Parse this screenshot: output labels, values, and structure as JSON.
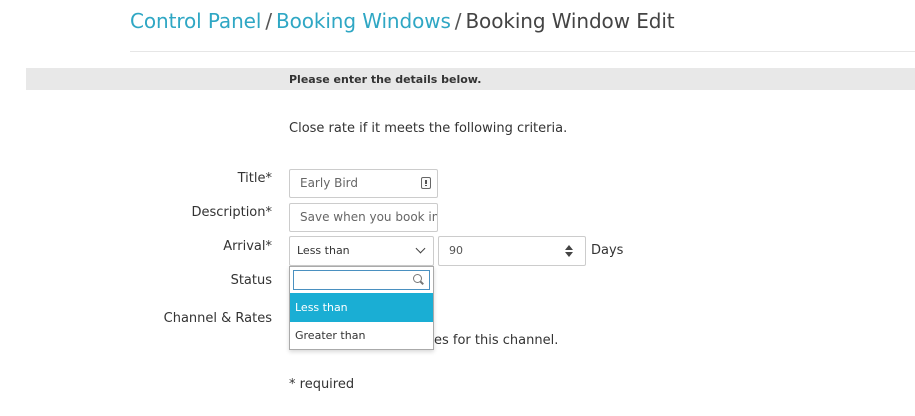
{
  "breadcrumb": {
    "items": [
      {
        "label": "Control Panel"
      },
      {
        "label": "Booking Windows"
      },
      {
        "label": "Booking Window Edit"
      }
    ],
    "separator": "/",
    "link_color": "#2fa7c4"
  },
  "info_bar": {
    "text": "Please enter the details below."
  },
  "criteria_text": "Close rate if it meets the following criteria.",
  "form": {
    "title": {
      "label": "Title*",
      "value": "Early Bird",
      "icon": "field-info-icon"
    },
    "description": {
      "label": "Description*",
      "value": "Save when you book in"
    },
    "arrival": {
      "label": "Arrival*",
      "selected": "Less than",
      "number_value": "90",
      "unit": "Days",
      "dropdown": {
        "search_value": "",
        "options": [
          {
            "label": "Less than",
            "selected": true
          },
          {
            "label": "Greater than",
            "selected": false
          }
        ],
        "highlight_color": "#1aaed4"
      }
    },
    "status": {
      "label": "Status"
    },
    "channel_rates": {
      "label": "Channel & Rates",
      "partial_text": "es for this channel."
    }
  },
  "required_note": "* required"
}
